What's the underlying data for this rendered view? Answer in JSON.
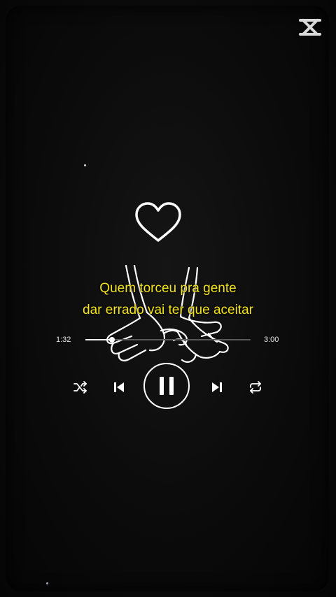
{
  "lyrics": {
    "line1": "Quem torceu pra gente",
    "line2": "dar errado vai ter que aceitar"
  },
  "player": {
    "time_elapsed": "1:32",
    "time_total": "3:00",
    "progress": 0.16,
    "state": "playing"
  },
  "icons": {
    "watermark": "capcut-logo",
    "artwork": [
      "heart-icon",
      "holding-hands-illustration"
    ],
    "controls": [
      "shuffle-icon",
      "previous-icon",
      "pause-icon",
      "next-icon",
      "repeat-icon"
    ]
  },
  "colors": {
    "lyrics": "#f4e41c",
    "background": "#0a0a0a",
    "foreground": "#ffffff"
  }
}
